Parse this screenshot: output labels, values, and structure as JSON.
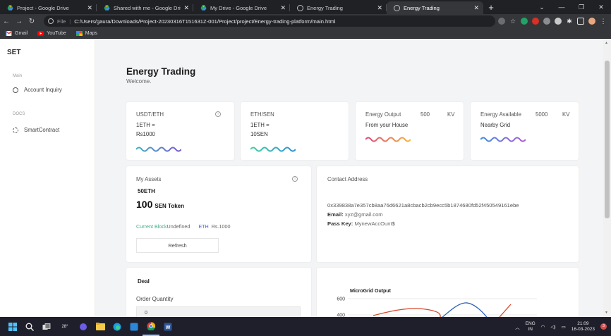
{
  "browser": {
    "tabs": [
      {
        "label": "Project - Google Drive",
        "icon": "google-drive-icon",
        "active": false
      },
      {
        "label": "Shared with me - Google Drive",
        "icon": "google-drive-icon",
        "active": false
      },
      {
        "label": "My Drive - Google Drive",
        "icon": "google-drive-icon",
        "active": false
      },
      {
        "label": "Energy Trading",
        "icon": "globe-icon",
        "active": false
      },
      {
        "label": "Energy Trading",
        "icon": "globe-icon",
        "active": true
      }
    ],
    "url_scheme": "File",
    "url": "C:/Users/gaura/Downloads/Project-20230316T151631Z-001/Project/project/Energy-trading-platform/main.html",
    "bookmarks": [
      {
        "label": "Gmail",
        "icon": "gmail-icon"
      },
      {
        "label": "YouTube",
        "icon": "youtube-icon"
      },
      {
        "label": "Maps",
        "icon": "maps-icon"
      }
    ]
  },
  "sidebar": {
    "brand": "SET",
    "sections": [
      {
        "heading": "Main",
        "items": [
          {
            "label": "Account Inquiry",
            "icon": "account-icon"
          }
        ]
      },
      {
        "heading": "DOCS",
        "items": [
          {
            "label": "SmartContract",
            "icon": "contract-icon"
          }
        ]
      }
    ]
  },
  "page": {
    "title": "Energy Trading",
    "subtitle": "Welcome."
  },
  "stats": [
    {
      "title": "USDT/ETH",
      "line1": "1ETH =",
      "line2": "Rs1000"
    },
    {
      "title": "ETH/SEN",
      "line1": "1ETH =",
      "line2": "10SEN"
    },
    {
      "title": "Energy Output",
      "value": "500",
      "unit": "KV",
      "line1": "From your House"
    },
    {
      "title": "Energy Available",
      "value": "5000",
      "unit": "KV",
      "line1": "Nearby Grid"
    }
  ],
  "assets": {
    "title": "My Assets",
    "eth_amount": "50ETH",
    "token_amount": "100",
    "token_label": "SEN Token",
    "block_label": "Current Block",
    "block_value": "Undefined",
    "eth_label": "ETH",
    "eth_value": "Rs.1000",
    "refresh_label": "Refresh"
  },
  "contact": {
    "title": "Contact Address",
    "address": "0x339838a7e357cb8aa76d6621a8cbacb2cb9ecc5b1874680fd52f450549161ebe",
    "email_label": "Email:",
    "email_value": "xyz@gmail.com",
    "passkey_label": "Pass Key:",
    "passkey_value": "MynewAccOunt$"
  },
  "deal": {
    "title": "Deal",
    "quantity_label": "Order Quantity",
    "quantity_value": "0"
  },
  "chart_data": {
    "type": "line",
    "title": "MicroGrid Output",
    "y_ticks": [
      600,
      400
    ],
    "series_colors": [
      "#d9472b",
      "#2f62b8"
    ]
  },
  "taskbar": {
    "temperature": "28°",
    "lang_line1": "ENG",
    "lang_line2": "IN",
    "time": "21:09",
    "date": "16-03-2023",
    "notifications": "3"
  },
  "colors": {
    "accent_green": "#3fae8a",
    "accent_blue": "#5468c9"
  }
}
